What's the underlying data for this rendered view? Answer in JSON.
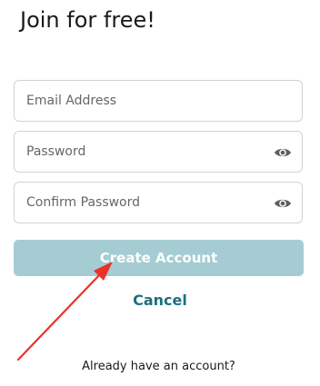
{
  "title": "Join for free!",
  "form": {
    "email": {
      "placeholder": "Email Address",
      "value": ""
    },
    "password": {
      "placeholder": "Password",
      "value": "",
      "reveal_icon": "eye-icon"
    },
    "confirm_password": {
      "placeholder": "Confirm Password",
      "value": "",
      "reveal_icon": "eye-icon"
    }
  },
  "actions": {
    "create_label": "Create Account",
    "cancel_label": "Cancel",
    "existing_account_label": "Already have an account?"
  },
  "colors": {
    "primary_button": "#a5ccd3",
    "cancel_link": "#1d6e80",
    "field_border": "#cfd3d7",
    "annotation_arrow": "#e8322a"
  },
  "annotation": {
    "type": "red-arrow",
    "points_to": "create-account-button"
  }
}
